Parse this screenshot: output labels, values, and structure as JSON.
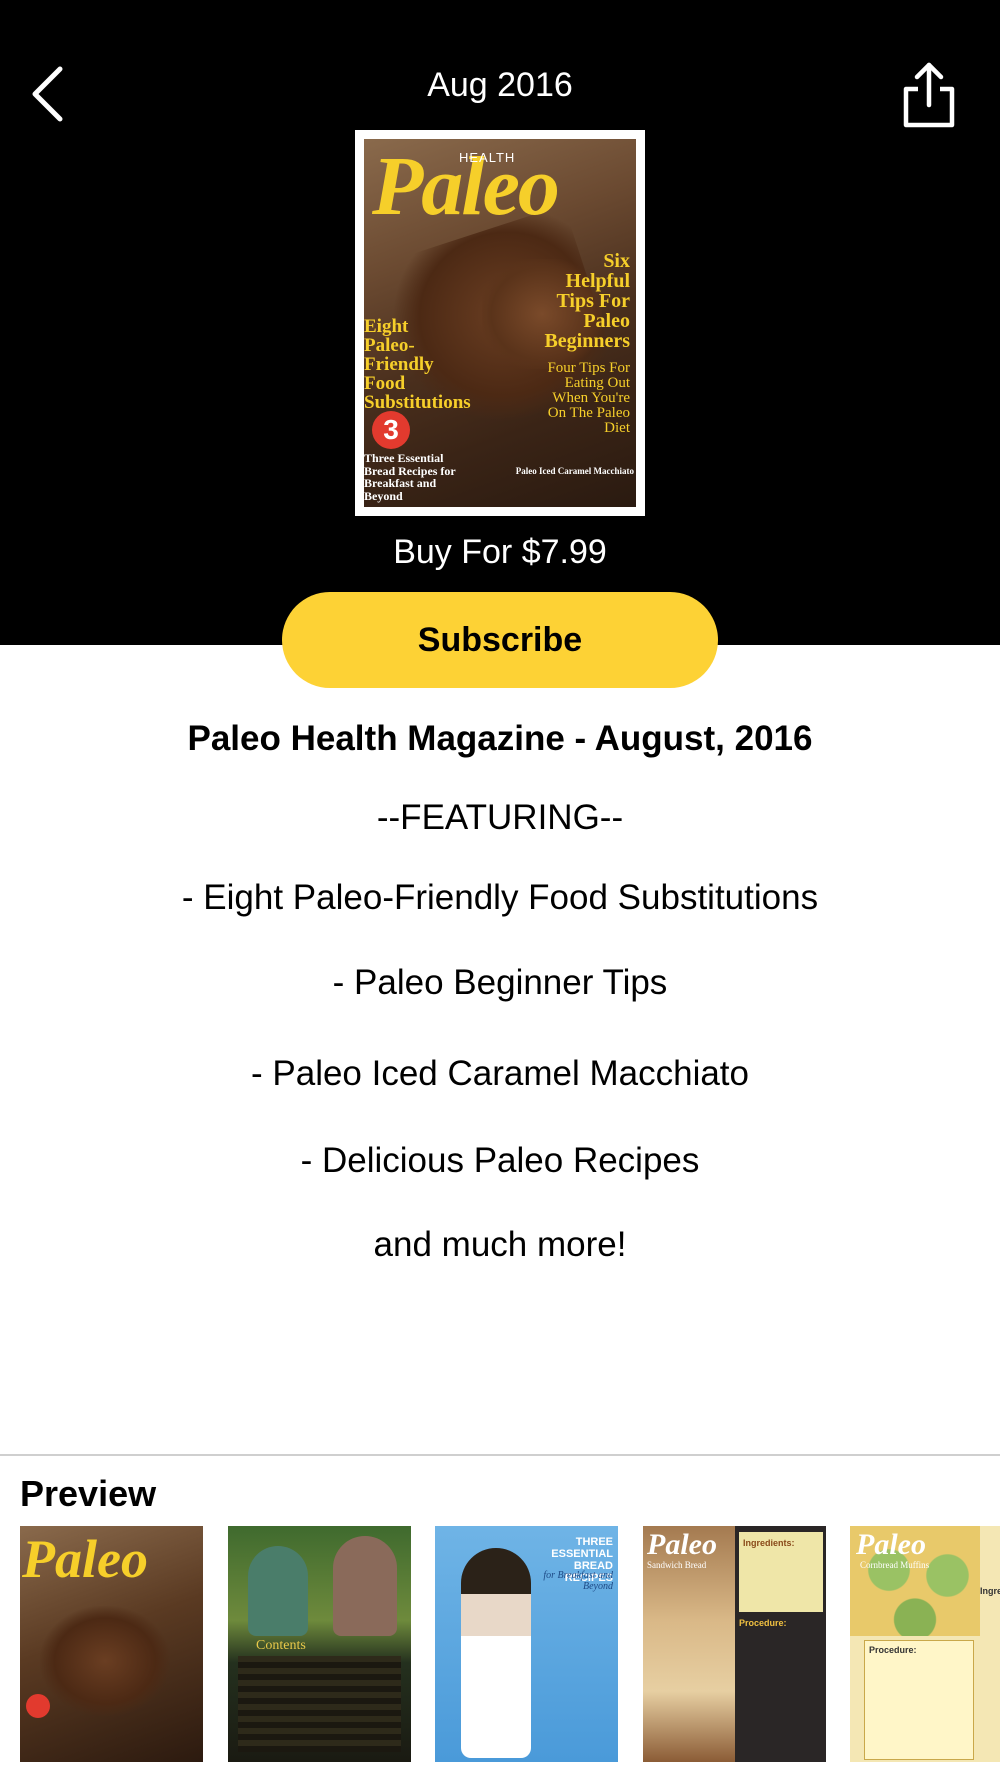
{
  "header": {
    "title": "Aug 2016",
    "back_icon": "chevron-left-icon",
    "share_icon": "share-icon"
  },
  "cover": {
    "brand": "Paleo",
    "health": "HEALTH",
    "left_block": "Eight Paleo-Friendly Food Substitutions",
    "right_block": "Six Helpful Tips For Paleo Beginners",
    "right_block2": "Four Tips For Eating Out When You're On The Paleo Diet",
    "badge": "3",
    "bottom_left": "Three Essential Bread Recipes for Breakfast and Beyond",
    "bottom_right": "Paleo Iced Caramel Macchiato"
  },
  "buy_label": "Buy For $7.99",
  "subscribe_label": "Subscribe",
  "description": {
    "title": "Paleo Health Magazine - August, 2016",
    "lines": [
      "--FEATURING--",
      "- Eight Paleo-Friendly Food Substitutions",
      "- Paleo Beginner Tips",
      "- Paleo Iced Caramel Macchiato",
      "- Delicious Paleo Recipes",
      "and much more!"
    ]
  },
  "preview": {
    "label": "Preview",
    "pages": [
      {
        "name": "cover",
        "heading": "Paleo"
      },
      {
        "name": "contents",
        "heading": "Contents"
      },
      {
        "name": "bread-recipes",
        "heading": "THREE ESSENTIAL BREAD RECIPES",
        "sub": "for Breakfast and Beyond"
      },
      {
        "name": "sandwich-bread",
        "heading": "Paleo",
        "sub": "Sandwich Bread",
        "side": "Ingredients:",
        "side2": "Procedure:"
      },
      {
        "name": "cornbread-muffins",
        "heading": "Paleo",
        "sub": "Cornbread Muffins",
        "side": "Ingredi",
        "side2": "Procedure:"
      }
    ]
  },
  "colors": {
    "header_bg": "#000000",
    "accent": "#fdd235",
    "badge": "#e23a2e"
  }
}
